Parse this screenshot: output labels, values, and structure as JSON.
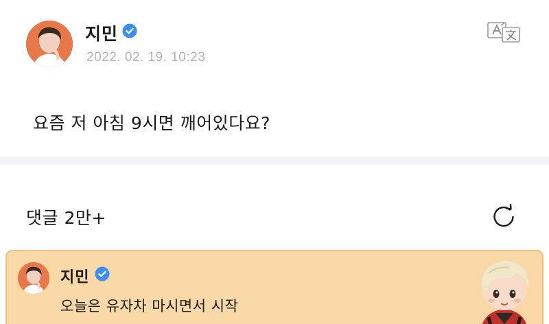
{
  "post": {
    "author": "지민",
    "timestamp": "2022. 02. 19. 10:23",
    "body": "요즘 저 아침 9시면 깨어있다요?",
    "translate_icon": "translate-icon",
    "verified_icon": "verified-badge-icon"
  },
  "comments": {
    "title": "댓글 2만+",
    "refresh_icon": "refresh-icon"
  },
  "pinned_comment": {
    "author": "지민",
    "text": "오늘은 유자차 마시면서 시작",
    "mascot_icon": "character-sticker-icon"
  },
  "colors": {
    "verified": "#3a8ef6",
    "timestamp": "#b3b3b3",
    "divider": "#f2f3f7",
    "pinned_bg": "#f7d8a6",
    "pinned_border": "#f0c27c",
    "avatar_bg": "#e8784a"
  }
}
